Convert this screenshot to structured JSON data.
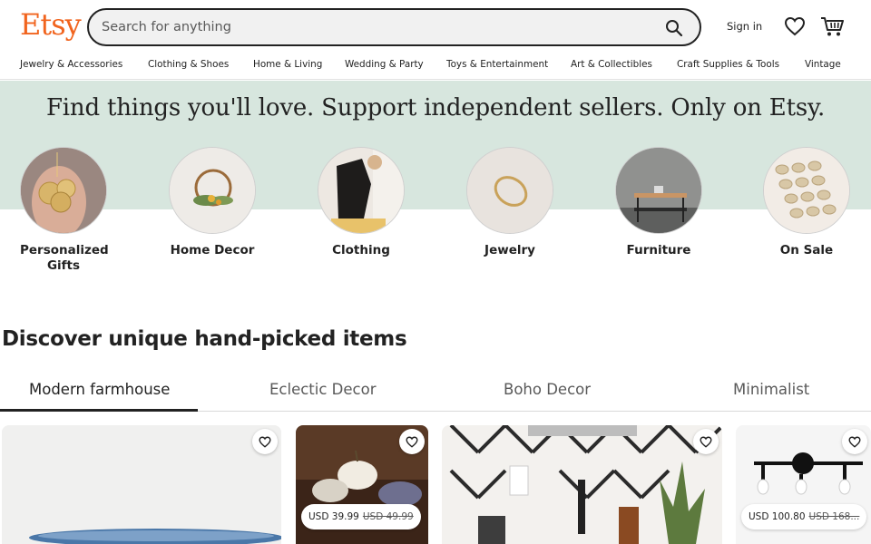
{
  "header": {
    "logo": "Etsy",
    "search_placeholder": "Search for anything",
    "sign_in": "Sign in",
    "icons": {
      "search": "search-icon",
      "favorites": "heart-icon",
      "cart": "cart-icon"
    },
    "brand_color": "#f1641e"
  },
  "categories_nav": [
    "Jewelry & Accessories",
    "Clothing & Shoes",
    "Home & Living",
    "Wedding & Party",
    "Toys & Entertainment",
    "Art & Collectibles",
    "Craft Supplies & Tools",
    "Vintage"
  ],
  "hero": {
    "title": "Find things you'll love. Support independent sellers. Only on Etsy.",
    "band_color": "#d7e6de",
    "categories": [
      {
        "label": "Personalized Gifts"
      },
      {
        "label": "Home Decor"
      },
      {
        "label": "Clothing"
      },
      {
        "label": "Jewelry"
      },
      {
        "label": "Furniture"
      },
      {
        "label": "On Sale"
      }
    ]
  },
  "discover": {
    "title": "Discover unique hand-picked items",
    "tabs": [
      "Modern farmhouse",
      "Eclectic Decor",
      "Boho Decor",
      "Minimalist"
    ],
    "active_tab": "Modern farmhouse",
    "cards": [
      {
        "price": "",
        "original_price": ""
      },
      {
        "price": "USD 39.99",
        "original_price": "USD 49.99"
      },
      {
        "price": "",
        "original_price": ""
      },
      {
        "price": "USD 100.80",
        "original_price": "USD 168..."
      }
    ]
  }
}
